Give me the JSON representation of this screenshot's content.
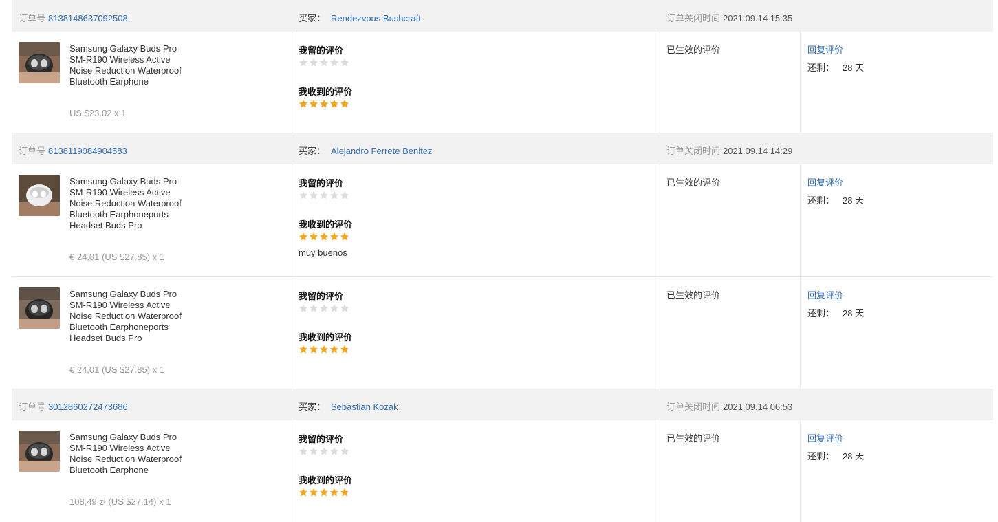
{
  "labels": {
    "order_no": "订单号",
    "buyer": "买家：",
    "close_time": "订单关闭时间",
    "my_review": "我留的评价",
    "received_review": "我收到的评价",
    "status": "已生效的评价",
    "reply": "回复评价",
    "remaining": "还剩：",
    "days": "28 天"
  },
  "colors": {
    "star_filled": "#f5a623",
    "star_empty": "#dcdcdc",
    "link": "#2e6db4",
    "header_bg": "#f2f2f2"
  },
  "orders": [
    {
      "order_no": "8138148637092508",
      "buyer": "Rendezvous Bushcraft",
      "close_time": "2021.09.14 15:35",
      "items": [
        {
          "title": "Samsung Galaxy Buds Pro SM-R190 Wireless Active Noise Reduction Waterproof Bluetooth Earphone",
          "price": "US $23.02 x 1",
          "my_rating": 0,
          "received_rating": 5,
          "comment": "",
          "remaining": "28 天"
        }
      ]
    },
    {
      "order_no": "8138119084904583",
      "buyer": "Alejandro Ferrete Benitez",
      "close_time": "2021.09.14 14:29",
      "items": [
        {
          "title": "Samsung Galaxy Buds Pro SM-R190 Wireless Active Noise Reduction Waterproof Bluetooth Earphoneports Headset Buds Pro",
          "price": "€ 24,01 (US $27.85) x 1",
          "my_rating": 0,
          "received_rating": 5,
          "comment": "muy buenos",
          "remaining": "28 天"
        },
        {
          "title": "Samsung Galaxy Buds Pro SM-R190 Wireless Active Noise Reduction Waterproof Bluetooth Earphoneports Headset Buds Pro",
          "price": "€ 24,01 (US $27.85) x 1",
          "my_rating": 0,
          "received_rating": 5,
          "comment": "",
          "remaining": "28 天"
        }
      ]
    },
    {
      "order_no": "3012860272473686",
      "buyer": "Sebastian Kozak",
      "close_time": "2021.09.14 06:53",
      "items": [
        {
          "title": "Samsung Galaxy Buds Pro SM-R190 Wireless Active Noise Reduction Waterproof Bluetooth Earphone",
          "price": "108,49 zł (US $27.14) x 1",
          "my_rating": 0,
          "received_rating": 5,
          "comment": "",
          "remaining": "28 天"
        }
      ]
    }
  ]
}
